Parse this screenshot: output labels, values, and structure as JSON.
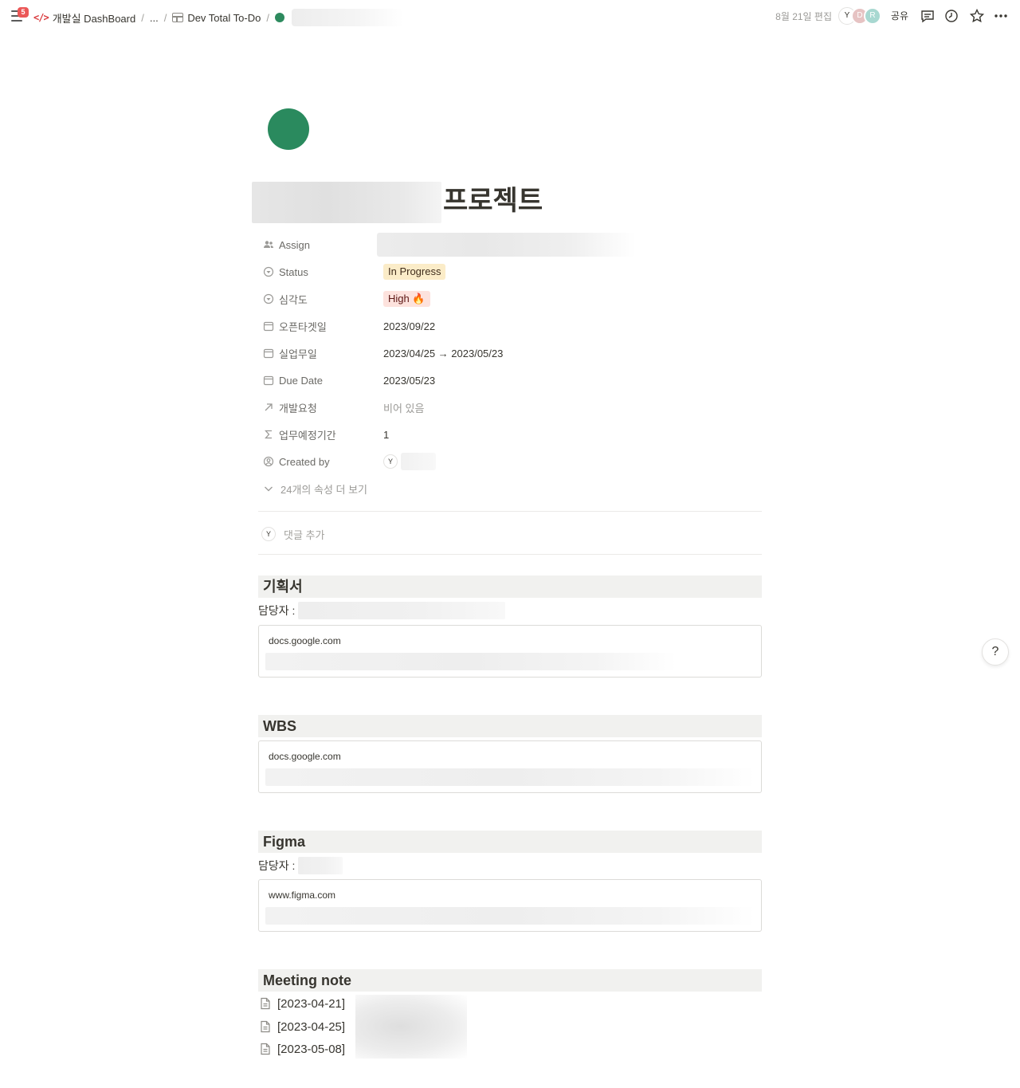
{
  "topbar": {
    "notification_count": "5",
    "breadcrumbs": {
      "workspace": "개발실 DashBoard",
      "sep": "/",
      "ellipsis": "...",
      "database": "Dev Total To-Do"
    },
    "edited": "8월 21일 편집",
    "avatars": [
      "Y",
      "D",
      "R"
    ],
    "share_label": "공유"
  },
  "page": {
    "title": "프로젝트",
    "icon_color": "#2a8a5e"
  },
  "properties": [
    {
      "name": "Assign",
      "icon": "people-icon"
    },
    {
      "name": "Status",
      "icon": "status-icon",
      "value": "In Progress"
    },
    {
      "name": "심각도",
      "icon": "select-icon",
      "value": "High 🔥"
    },
    {
      "name": "오픈타겟일",
      "icon": "calendar-icon",
      "value": "2023/09/22"
    },
    {
      "name": "실업무일",
      "icon": "calendar-icon",
      "value": "2023/04/25 → 2023/05/23"
    },
    {
      "name": "Due Date",
      "icon": "calendar-icon",
      "value": "2023/05/23"
    },
    {
      "name": "개발요청",
      "icon": "relation-arrow-icon",
      "value": "비어 있음"
    },
    {
      "name": "업무예정기간",
      "icon": "sigma-icon",
      "value": "1"
    },
    {
      "name": "Created by",
      "icon": "person-circle-icon",
      "value": "Y"
    }
  ],
  "more_properties": "24개의 속성 더 보기",
  "comment": {
    "avatar": "Y",
    "placeholder": "댓글 추가"
  },
  "sections": {
    "plan": {
      "heading": "기획서",
      "manager_label": "담당자 :",
      "bookmark_url": "docs.google.com"
    },
    "wbs": {
      "heading": "WBS",
      "bookmark_url": "docs.google.com"
    },
    "figma": {
      "heading": "Figma",
      "manager_label": "담당자 :",
      "bookmark_url": "www.figma.com"
    },
    "meeting": {
      "heading": "Meeting note",
      "items": [
        "[2023-04-21]",
        "[2023-04-25]",
        "[2023-05-08]"
      ]
    }
  },
  "help_label": "?",
  "colors": {
    "status_bg": "#fbecc8",
    "high_bg": "#fde2dd",
    "badge": "#eb5757",
    "code_icon": "#d9383b"
  }
}
